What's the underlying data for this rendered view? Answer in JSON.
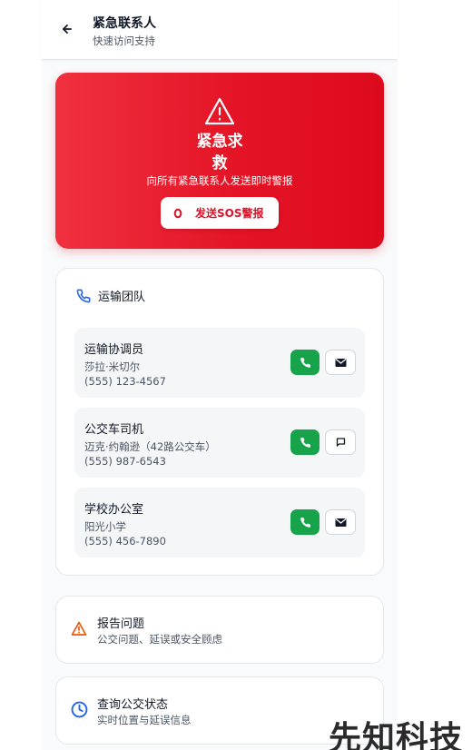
{
  "header": {
    "title": "紧急联系人",
    "subtitle": "快速访问支持",
    "back_icon": "arrow-left-icon"
  },
  "sos": {
    "title": "紧急求救",
    "description": "向所有紧急联系人发送即时警报",
    "button_label": "发送SOS警报",
    "icon": "alert-triangle-icon",
    "colors": {
      "gradient_start": "#f0303f",
      "gradient_end": "#dc0a1c"
    }
  },
  "team": {
    "title": "运输团队",
    "icon": "phone-icon",
    "contacts": [
      {
        "role": "运输协调员",
        "name": "莎拉·米切尔",
        "phone": "(555) 123-4567",
        "secondary_icon": "mail-icon"
      },
      {
        "role": "公交车司机",
        "name": "迈克·约翰逊（42路公交车）",
        "phone": "(555) 987-6543",
        "secondary_icon": "message-icon"
      },
      {
        "role": "学校办公室",
        "name": "阳光小学",
        "phone": "(555) 456-7890",
        "secondary_icon": "mail-icon"
      }
    ]
  },
  "actions": [
    {
      "title": "报告问题",
      "subtitle": "公交问题、延误或安全顾虑",
      "icon": "alert-triangle-icon",
      "color": "#ea580c"
    },
    {
      "title": "查询公交状态",
      "subtitle": "实时位置与延误信息",
      "icon": "clock-icon",
      "color": "#2563eb"
    }
  ],
  "watermark": "先知科技",
  "colors": {
    "call_green": "#16a34a",
    "accent_red": "#dc1228"
  }
}
